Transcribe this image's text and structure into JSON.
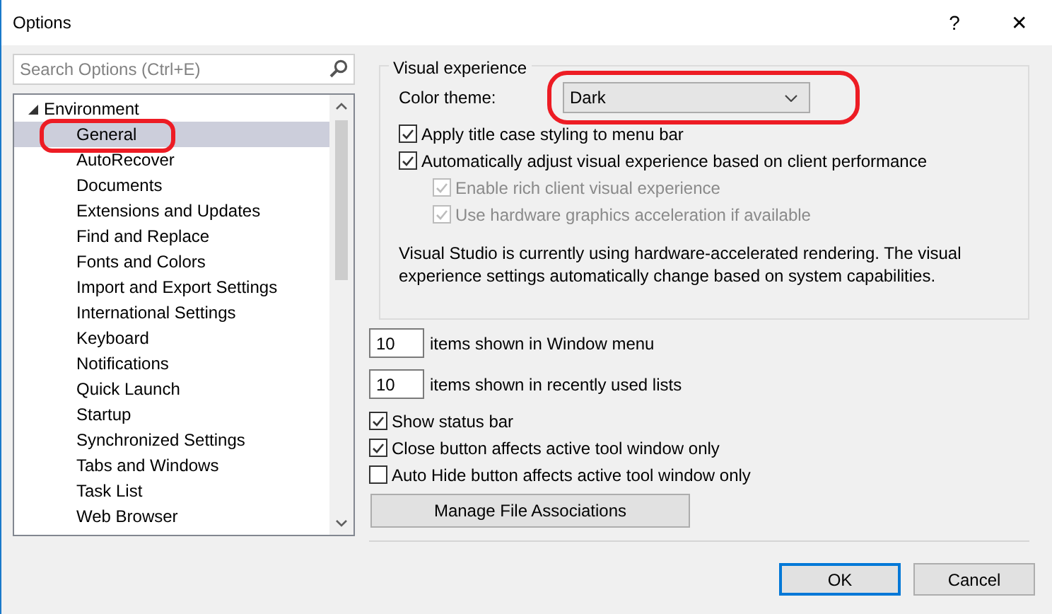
{
  "window": {
    "title": "Options",
    "help": "?",
    "close": "✕"
  },
  "search": {
    "placeholder": "Search Options (Ctrl+E)"
  },
  "tree": [
    {
      "label": "Environment",
      "expanded": true,
      "selected": false,
      "children": [
        {
          "label": "General",
          "selected": true,
          "circled": true
        },
        {
          "label": "AutoRecover",
          "selected": false
        },
        {
          "label": "Documents",
          "selected": false
        },
        {
          "label": "Extensions and Updates",
          "selected": false
        },
        {
          "label": "Find and Replace",
          "selected": false
        },
        {
          "label": "Fonts and Colors",
          "selected": false
        },
        {
          "label": "Import and Export Settings",
          "selected": false
        },
        {
          "label": "International Settings",
          "selected": false
        },
        {
          "label": "Keyboard",
          "selected": false
        },
        {
          "label": "Notifications",
          "selected": false
        },
        {
          "label": "Quick Launch",
          "selected": false
        },
        {
          "label": "Startup",
          "selected": false
        },
        {
          "label": "Synchronized Settings",
          "selected": false
        },
        {
          "label": "Tabs and Windows",
          "selected": false
        },
        {
          "label": "Task List",
          "selected": false
        },
        {
          "label": "Web Browser",
          "selected": false
        }
      ]
    }
  ],
  "visual_experience": {
    "title": "Visual experience",
    "color_theme": {
      "label": "Color theme:",
      "value": "Dark",
      "circled": true
    },
    "options": [
      {
        "label": "Apply title case styling to menu bar",
        "checked": true,
        "disabled": false
      },
      {
        "label": "Automatically adjust visual experience based on client performance",
        "checked": true,
        "disabled": false,
        "children": [
          {
            "label": "Enable rich client visual experience",
            "checked": true,
            "disabled": true
          },
          {
            "label": "Use hardware graphics acceleration if available",
            "checked": true,
            "disabled": true
          }
        ]
      }
    ],
    "note": "Visual Studio is currently using hardware-accelerated rendering. The visual experience settings automatically change based on system capabilities."
  },
  "counts": [
    {
      "value": "10",
      "label": "items shown in Window menu"
    },
    {
      "value": "10",
      "label": "items shown in recently used lists"
    }
  ],
  "options": [
    {
      "label": "Show status bar",
      "checked": true
    },
    {
      "label": "Close button affects active tool window only",
      "checked": true
    },
    {
      "label": "Auto Hide button affects active tool window only",
      "checked": false
    }
  ],
  "manage_button": "Manage File Associations",
  "buttons": [
    {
      "label": "OK",
      "default": true
    },
    {
      "label": "Cancel",
      "default": false
    }
  ]
}
